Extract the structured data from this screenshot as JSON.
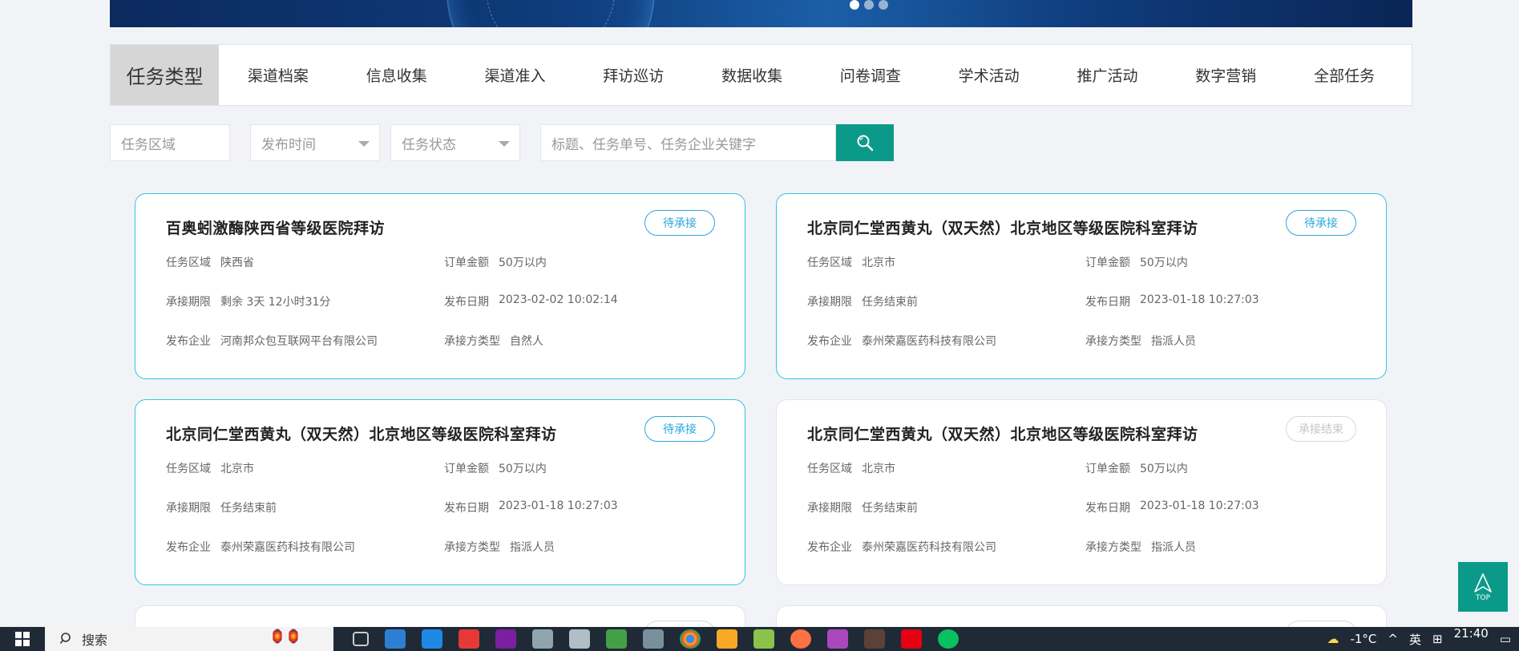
{
  "banner": {
    "slides": 3,
    "active_slide": 0
  },
  "categories": {
    "label": "任务类型",
    "items": [
      "渠道档案",
      "信息收集",
      "渠道准入",
      "拜访巡访",
      "数据收集",
      "问卷调查",
      "学术活动",
      "推广活动",
      "数字营销",
      "全部任务"
    ]
  },
  "filters": {
    "region_placeholder": "任务区域",
    "time_placeholder": "发布时间",
    "status_placeholder": "任务状态",
    "search_placeholder": "标题、任务单号、任务企业关键字"
  },
  "cards": [
    {
      "title": "百奥蚓激酶陕西省等级医院拜访",
      "status": "待承接",
      "region_label": "任务区域",
      "region": "陕西省",
      "amount_label": "订单金额",
      "amount": "50万以内",
      "deadline_label": "承接期限",
      "deadline": "剩余 3天 12小时31分",
      "date_label": "发布日期",
      "date": "2023-02-02 10:02:14",
      "company_label": "发布企业",
      "company": "河南邦众包互联网平台有限公司",
      "type_label": "承接方类型",
      "type": "自然人"
    },
    {
      "title": "北京同仁堂西黄丸（双天然）北京地区等级医院科室拜访",
      "status": "待承接",
      "region_label": "任务区域",
      "region": "北京市",
      "amount_label": "订单金额",
      "amount": "50万以内",
      "deadline_label": "承接期限",
      "deadline": "任务结束前",
      "date_label": "发布日期",
      "date": "2023-01-18 10:27:03",
      "company_label": "发布企业",
      "company": "泰州荣嘉医药科技有限公司",
      "type_label": "承接方类型",
      "type": "指派人员"
    },
    {
      "title": "北京同仁堂西黄丸（双天然）北京地区等级医院科室拜访",
      "status": "待承接",
      "region_label": "任务区域",
      "region": "北京市",
      "amount_label": "订单金额",
      "amount": "50万以内",
      "deadline_label": "承接期限",
      "deadline": "任务结束前",
      "date_label": "发布日期",
      "date": "2023-01-18 10:27:03",
      "company_label": "发布企业",
      "company": "泰州荣嘉医药科技有限公司",
      "type_label": "承接方类型",
      "type": "指派人员"
    },
    {
      "title": "北京同仁堂西黄丸（双天然）北京地区等级医院科室拜访",
      "status": "承接结束",
      "region_label": "任务区域",
      "region": "北京市",
      "amount_label": "订单金额",
      "amount": "50万以内",
      "deadline_label": "承接期限",
      "deadline": "任务结束前",
      "date_label": "发布日期",
      "date": "2023-01-18 10:27:03",
      "company_label": "发布企业",
      "company": "泰州荣嘉医药科技有限公司",
      "type_label": "承接方类型",
      "type": "指派人员"
    }
  ],
  "top_button": {
    "label": "TOP"
  },
  "taskbar": {
    "search_label": "搜索",
    "weather": "-1°C",
    "ime": "英",
    "time": "21:40"
  },
  "colors": {
    "accent": "#0b9a8a",
    "card_border": "#2ec5e6",
    "badge": "#2ea6d8"
  }
}
